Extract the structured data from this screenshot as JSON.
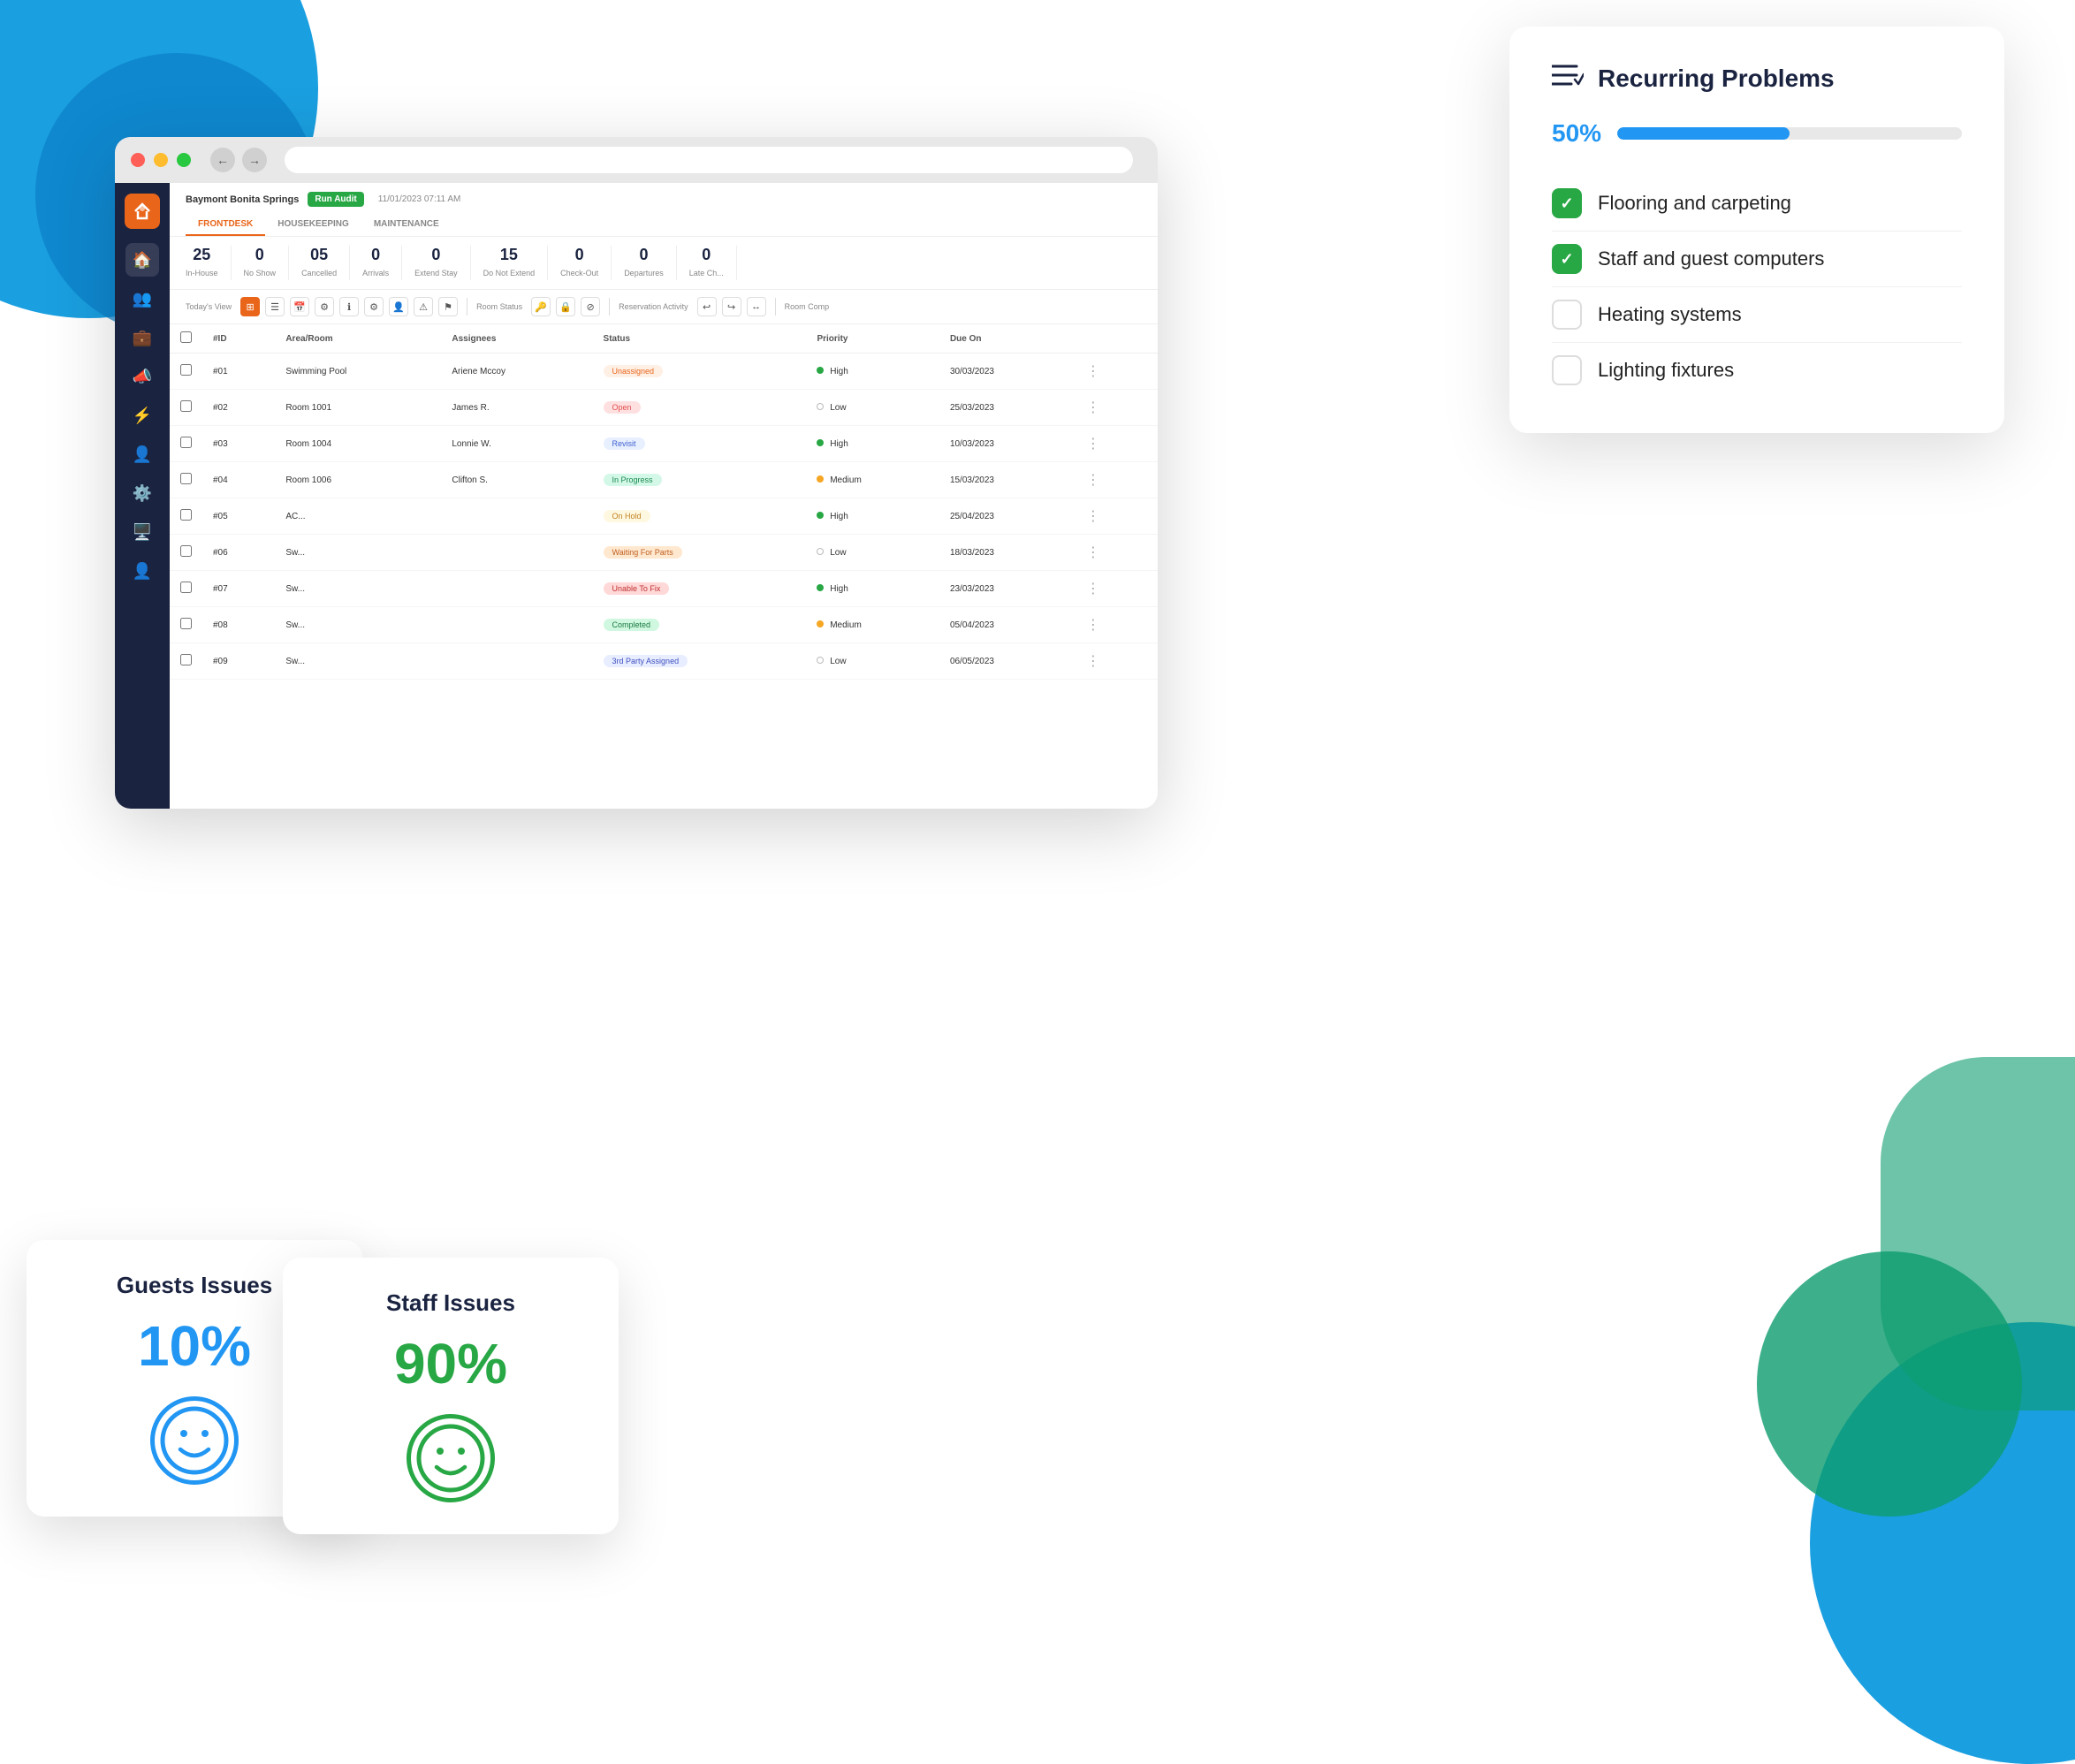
{
  "blobs": {},
  "browser": {
    "tabs": [
      {
        "label": "FRONTDESK",
        "active": true
      },
      {
        "label": "HOUSEKEEPING",
        "active": false
      },
      {
        "label": "MAINTENANCE",
        "active": false
      }
    ],
    "property": "Baymont Bonita Springs",
    "run_audit": "Run Audit",
    "datetime": "11/01/2023 07:11 AM",
    "stats": [
      {
        "number": "25",
        "label": "In-House"
      },
      {
        "number": "0",
        "label": "No Show"
      },
      {
        "number": "05",
        "label": "Cancelled"
      },
      {
        "number": "0",
        "label": "Arrivals"
      },
      {
        "number": "0",
        "label": "Extend Stay"
      },
      {
        "number": "15",
        "label": "Do Not Extend"
      },
      {
        "number": "0",
        "label": "Check-Out"
      },
      {
        "number": "0",
        "label": "Departures"
      },
      {
        "number": "0",
        "label": "Late Ch..."
      }
    ],
    "toolbar": {
      "today_view": "Today's View",
      "room_status": "Room Status",
      "reservation_activity": "Reservation Activity",
      "room_comp": "Room Comp"
    },
    "table": {
      "columns": [
        "",
        "#ID",
        "Area/Room",
        "Assignees",
        "Status",
        "Priority",
        "Due On",
        ""
      ],
      "rows": [
        {
          "id": "#01",
          "area": "Swimming Pool",
          "assignee": "Ariene Mccoy",
          "status": "Unassigned",
          "status_class": "badge-unassigned",
          "priority": "High",
          "priority_dot": "green",
          "due": "30/03/2023"
        },
        {
          "id": "#02",
          "area": "Room 1001",
          "assignee": "James R.",
          "status": "Open",
          "status_class": "badge-open",
          "priority": "Low",
          "priority_dot": "gray",
          "due": "25/03/2023"
        },
        {
          "id": "#03",
          "area": "Room 1004",
          "assignee": "Lonnie W.",
          "status": "Revisit",
          "status_class": "badge-revisit",
          "priority": "High",
          "priority_dot": "green",
          "due": "10/03/2023"
        },
        {
          "id": "#04",
          "area": "Room 1006",
          "assignee": "Clifton S.",
          "status": "In Progress",
          "status_class": "badge-inprogress",
          "priority": "Medium",
          "priority_dot": "yellow",
          "due": "15/03/2023"
        },
        {
          "id": "#05",
          "area": "AC...",
          "assignee": "",
          "status": "On Hold",
          "status_class": "badge-onhold",
          "priority": "High",
          "priority_dot": "green",
          "due": "25/04/2023"
        },
        {
          "id": "#06",
          "area": "Sw...",
          "assignee": "",
          "status": "Waiting For Parts",
          "status_class": "badge-waitingparts",
          "priority": "Low",
          "priority_dot": "gray",
          "due": "18/03/2023"
        },
        {
          "id": "#07",
          "area": "Sw...",
          "assignee": "",
          "status": "Unable To Fix",
          "status_class": "badge-unabletofix",
          "priority": "High",
          "priority_dot": "green",
          "due": "23/03/2023"
        },
        {
          "id": "#08",
          "area": "Sw...",
          "assignee": "",
          "status": "Completed",
          "status_class": "badge-completed",
          "priority": "Medium",
          "priority_dot": "yellow",
          "due": "05/04/2023"
        },
        {
          "id": "#09",
          "area": "Sw...",
          "assignee": "",
          "status": "3rd Party Assigned",
          "status_class": "badge-partyassigned",
          "priority": "Low",
          "priority_dot": "gray",
          "due": "06/05/2023"
        }
      ]
    }
  },
  "recurring_problems": {
    "title": "Recurring Problems",
    "progress_pct": "50%",
    "progress_value": 50,
    "items": [
      {
        "label": "Flooring and carpeting",
        "checked": true
      },
      {
        "label": "Staff and guest computers",
        "checked": true
      },
      {
        "label": "Heating systems",
        "checked": false
      },
      {
        "label": "Lighting fixtures",
        "checked": false
      }
    ]
  },
  "guests_issues": {
    "title": "Guests Issues",
    "percentage": "10%",
    "smiley_color": "#2196f3"
  },
  "staff_issues": {
    "title": "Staff Issues",
    "percentage": "90%",
    "smiley_color": "#28a745"
  },
  "sidebar": {
    "logo_text": "⌂",
    "icons": [
      {
        "name": "home",
        "symbol": "⌂",
        "active": false
      },
      {
        "name": "users",
        "symbol": "👥",
        "active": false
      },
      {
        "name": "briefcase",
        "symbol": "💼",
        "active": false
      },
      {
        "name": "megaphone",
        "symbol": "📣",
        "active": false
      },
      {
        "name": "alert",
        "symbol": "⚡",
        "active": false
      },
      {
        "name": "person",
        "symbol": "👤",
        "active": false
      },
      {
        "name": "settings",
        "symbol": "⚙",
        "active": false
      },
      {
        "name": "monitor",
        "symbol": "🖥",
        "active": false
      },
      {
        "name": "profile",
        "symbol": "👤",
        "active": false
      }
    ]
  }
}
